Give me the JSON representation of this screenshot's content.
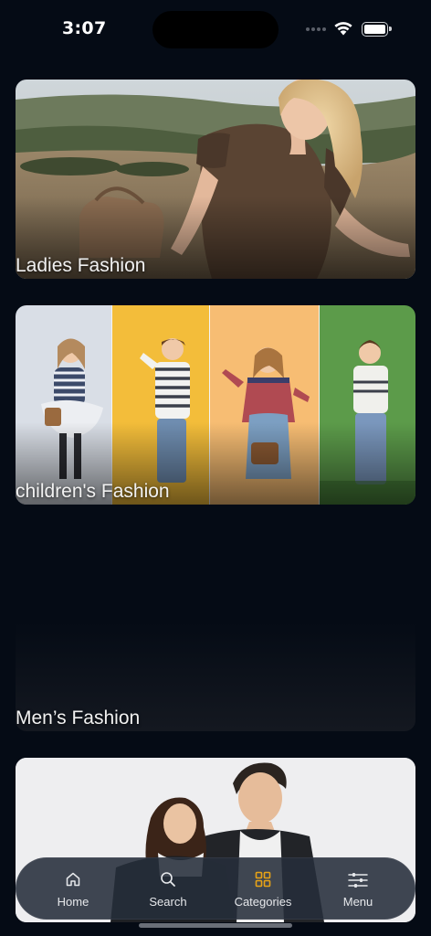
{
  "status_bar": {
    "time": "3:07"
  },
  "categories": [
    {
      "label": "Ladies Fashion"
    },
    {
      "label": "children's Fashion"
    },
    {
      "label": "Men’s Fashion"
    },
    {
      "label": ""
    }
  ],
  "tab_bar": {
    "items": [
      {
        "label": "Home",
        "icon": "home-icon"
      },
      {
        "label": "Search",
        "icon": "search-icon"
      },
      {
        "label": "Categories",
        "icon": "grid-icon",
        "active": true
      },
      {
        "label": "Menu",
        "icon": "sliders-icon"
      }
    ],
    "active_color": "#e8a317"
  }
}
